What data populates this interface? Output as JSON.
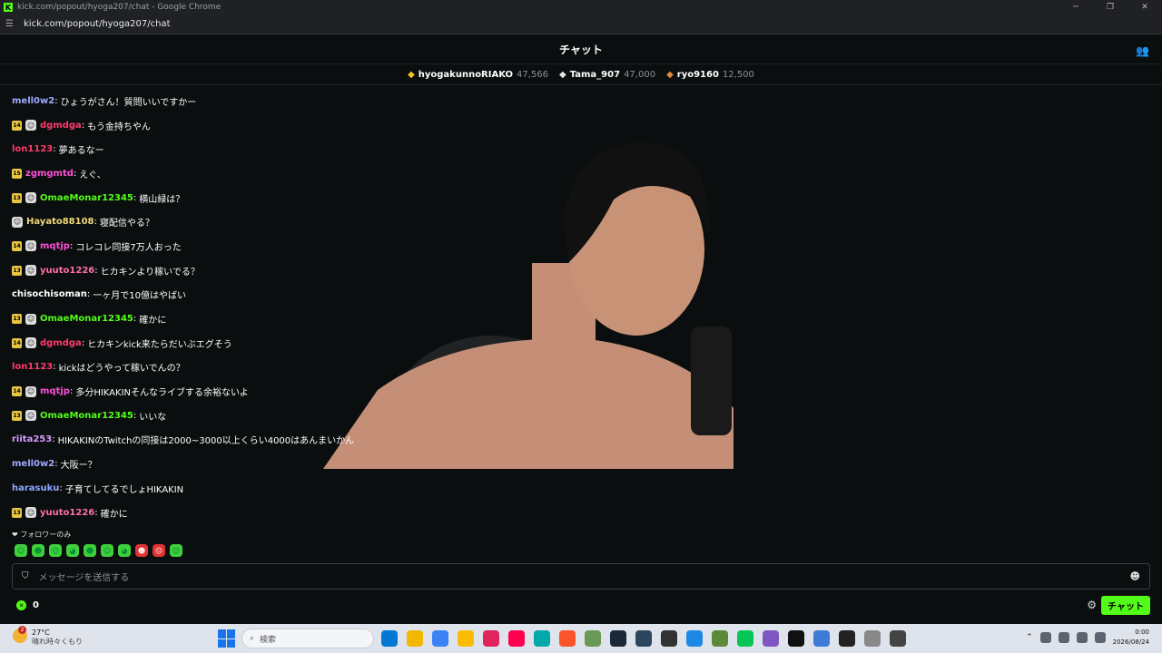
{
  "window": {
    "title": "kick.com/popout/hyoga207/chat - Google Chrome",
    "url": "kick.com/popout/hyoga207/chat"
  },
  "chat": {
    "title": "チャット",
    "leaderboard": [
      {
        "name": "hyogakunnoRIAKO",
        "points": "47,566",
        "color": "#f5c518"
      },
      {
        "name": "Tama_907",
        "points": "47,000",
        "color": "#e5e5e5"
      },
      {
        "name": "ryo9160",
        "points": "12,500",
        "color": "#e08a3c"
      }
    ],
    "messages": [
      {
        "sub": "",
        "og": false,
        "user": "mell0w2",
        "color": "#9fa8ff",
        "text": "ひょうがさん！質問いいですかー"
      },
      {
        "sub": "14",
        "og": true,
        "user": "dgmdga",
        "color": "#ff3b6b",
        "text": "もう金持ちやん"
      },
      {
        "sub": "",
        "og": false,
        "user": "lon1123",
        "color": "#ff3b6b",
        "text": "夢あるなー"
      },
      {
        "sub": "15",
        "og": false,
        "user": "zgmgmtd",
        "color": "#ff4fd8",
        "text": "えぐ、"
      },
      {
        "sub": "13",
        "og": true,
        "user": "OmaeMonar12345",
        "color": "#53fc18",
        "text": "横山緑は？"
      },
      {
        "sub": "",
        "og": true,
        "user": "Hayato88108",
        "color": "#f0d97a",
        "text": "寝配信やる？"
      },
      {
        "sub": "14",
        "og": true,
        "user": "mqtjp",
        "color": "#ff4fd8",
        "text": "コレコレ同接7万人おった"
      },
      {
        "sub": "13",
        "og": true,
        "user": "yuuto1226",
        "color": "#ff6fa8",
        "text": "ヒカキンより稼いでる？"
      },
      {
        "sub": "",
        "og": false,
        "user": "chisochisoman",
        "color": "#ffffff",
        "text": "一ヶ月で10億はやばい"
      },
      {
        "sub": "13",
        "og": true,
        "user": "OmaeMonar12345",
        "color": "#53fc18",
        "text": "確かに"
      },
      {
        "sub": "14",
        "og": true,
        "user": "dgmdga",
        "color": "#ff3b6b",
        "text": "ヒカキンkick来たらだいぶエグそう"
      },
      {
        "sub": "",
        "og": false,
        "user": "lon1123",
        "color": "#ff3b6b",
        "text": "kickはどうやって稼いでんの？"
      },
      {
        "sub": "14",
        "og": true,
        "user": "mqtjp",
        "color": "#ff4fd8",
        "text": "多分HIKAKINそんなライブする余裕ないよ"
      },
      {
        "sub": "13",
        "og": true,
        "user": "OmaeMonar12345",
        "color": "#53fc18",
        "text": "いいな"
      },
      {
        "sub": "",
        "og": false,
        "user": "riita253",
        "color": "#d99cff",
        "text": "HIKAKINのTwitchの同接は2000~3000以上くらい4000はあんまいかん"
      },
      {
        "sub": "",
        "og": false,
        "user": "mell0w2",
        "color": "#9fa8ff",
        "text": "大阪ー？"
      },
      {
        "sub": "",
        "og": false,
        "user": "harasuku",
        "color": "#8fa8ff",
        "text": "子育てしてるでしょHIKAKIN"
      },
      {
        "sub": "13",
        "og": true,
        "user": "yuuto1226",
        "color": "#ff6fa8",
        "text": "確かに"
      }
    ],
    "followers_only": "フォロワーのみ",
    "input_placeholder": "メッセージを送信する",
    "points": "0",
    "send_label": "チャット"
  },
  "taskbar": {
    "temperature": "27°C",
    "weather": "晴れ時々くもり",
    "notif_count": "2",
    "search_placeholder": "検索",
    "time": "0:00",
    "date": "2026/08/24",
    "app_colors": [
      "#0078d4",
      "#f3b700",
      "#3b82f6",
      "#fbbc04",
      "#e0245e",
      "#ff0050",
      "#00a8a8",
      "#fb542b",
      "#6a9955",
      "#1b2838",
      "#2a475e",
      "#333333",
      "#1e88e5",
      "#5d8a3a",
      "#06c755",
      "#7e57c2",
      "#111111",
      "#3d7bd6",
      "#222222",
      "#888888",
      "#444444"
    ]
  }
}
